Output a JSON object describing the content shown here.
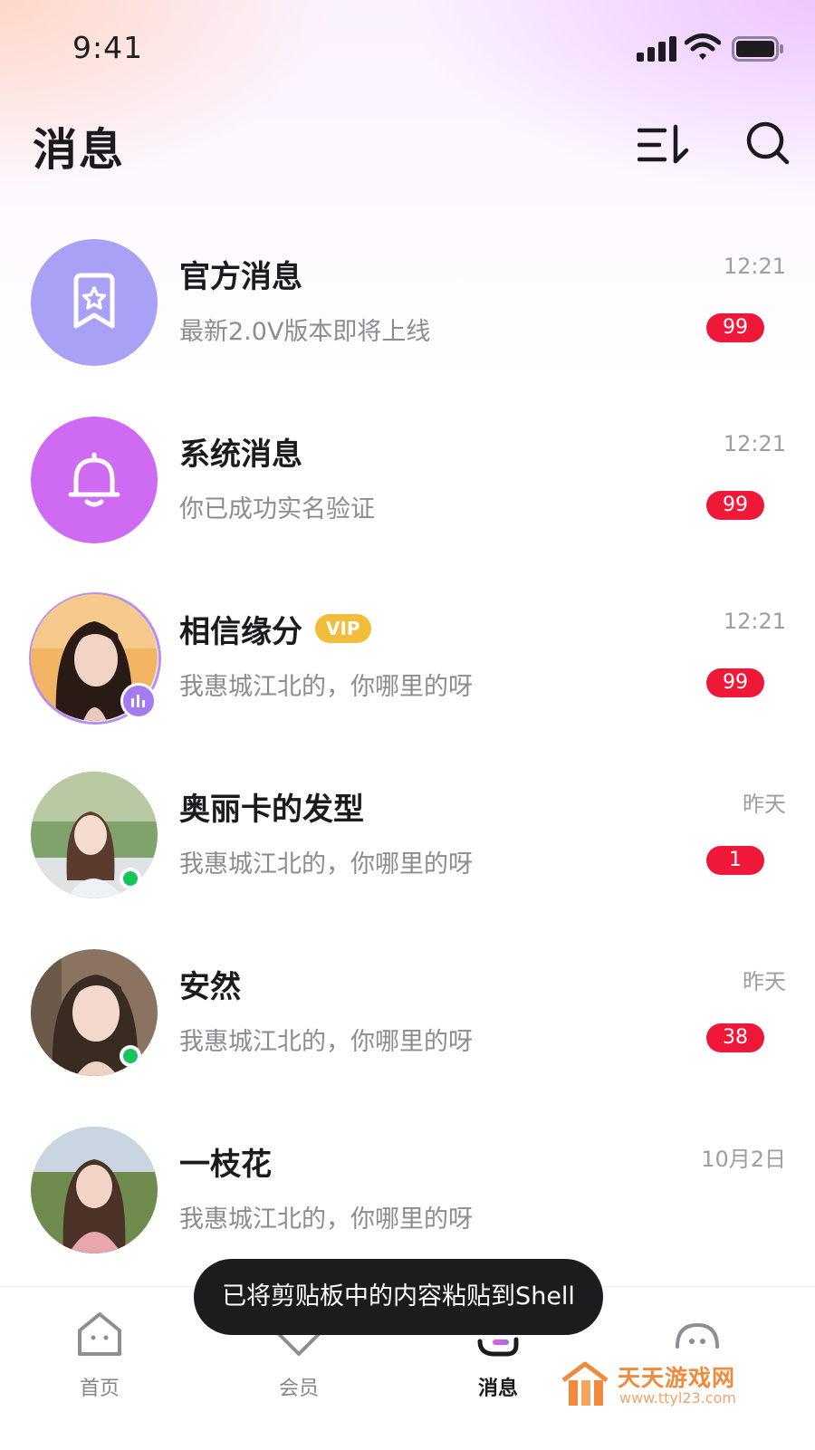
{
  "status_bar": {
    "time": "9:41"
  },
  "header": {
    "title": "消息"
  },
  "conversations": [
    {
      "name": "官方消息",
      "preview": "最新2.0V版本即将上线",
      "time": "12:21",
      "unread": "99"
    },
    {
      "name": "系统消息",
      "preview": "你已成功实名验证",
      "time": "12:21",
      "unread": "99"
    },
    {
      "name": "相信缘分",
      "vip": "VIP",
      "preview": "我惠城江北的，你哪里的呀",
      "time": "12:21",
      "unread": "99"
    },
    {
      "name": "奥丽卡的发型",
      "preview": "我惠城江北的，你哪里的呀",
      "time": "昨天",
      "unread": "1"
    },
    {
      "name": "安然",
      "preview": "我惠城江北的，你哪里的呀",
      "time": "昨天",
      "unread": "38"
    },
    {
      "name": "一枝花",
      "preview": "我惠城江北的，你哪里的呀",
      "time": "10月2日"
    }
  ],
  "tabs": [
    {
      "label": "首页",
      "icon": "home-icon"
    },
    {
      "label": "会员",
      "icon": "diamond-icon"
    },
    {
      "label": "消息",
      "icon": "message-icon",
      "active": true
    },
    {
      "label": "",
      "icon": "profile-icon"
    }
  ],
  "toast": {
    "text": "已将剪贴板中的内容粘贴到Shell"
  },
  "watermark": {
    "title": "天天游戏网",
    "url": "www.ttyl23.com"
  },
  "colors": {
    "accent": "#a27cf0",
    "unread": "#f01838",
    "online": "#16c45a",
    "vip": "#f2bd3a"
  }
}
